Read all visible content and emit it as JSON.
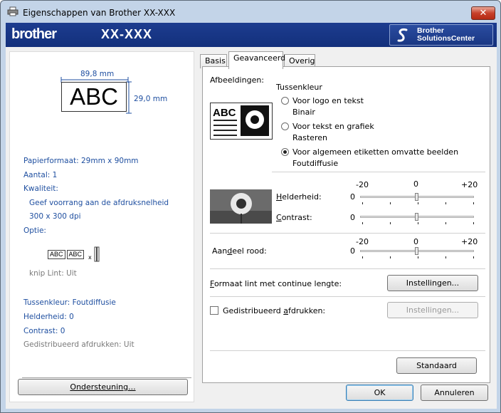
{
  "window": {
    "title": "Eigenschappen van Brother XX-XXX",
    "close_glyph": "✕"
  },
  "banner": {
    "brand": "brother",
    "model": "XX-XXX",
    "solutions_line1": "Brother",
    "solutions_line2": "SolutionsCenter"
  },
  "preview": {
    "width_label": "89,8 mm",
    "height_label": "29,0 mm",
    "sample_text": "ABC"
  },
  "info": {
    "paper": "Papierformaat: 29mm x 90mm",
    "copies": "Aantal: 1",
    "quality": "Kwaliteit:",
    "quality_value": "Geef voorrang aan de afdruksnelheid",
    "resolution": "300 x 300 dpi",
    "option": "Optie:",
    "option_sample": "ABC",
    "cut": "knip Lint: Uit",
    "halftone": "Tussenkleur: Foutdiffusie",
    "brightness": "Helderheid:  0",
    "contrast": "Contrast:  0",
    "distributed": "Gedistribueerd afdrukken: Uit"
  },
  "support_button": "Ondersteuning...",
  "tabs": [
    {
      "label": "Basis"
    },
    {
      "label": "Geavanceerd"
    },
    {
      "label": "Overig"
    }
  ],
  "advanced": {
    "images_label": "Afbeeldingen:",
    "halftone_label": "Tussenkleur",
    "options": [
      {
        "label": "Voor logo en tekst",
        "sub": "Binair",
        "selected": false
      },
      {
        "label": "Voor tekst en grafiek",
        "sub": "Rasteren",
        "selected": false
      },
      {
        "label": "Voor algemeen etiketten omvatte beelden",
        "sub": "Foutdiffusie",
        "selected": true
      }
    ],
    "scale": {
      "min": "-20",
      "mid": "0",
      "max": "+20"
    },
    "brightness_label": "Helderheid:",
    "brightness_value": "0",
    "brightness": 0,
    "contrast_label": "Contrast:",
    "contrast_value": "0",
    "contrast": 0,
    "red_label": "Aandeel rood:",
    "red_value": "0",
    "red": 0,
    "format_label": "Formaat lint met continue lengte:",
    "format_button": "Instellingen...",
    "distributed_label": "Gedistribueerd afdrukken:",
    "distributed_checked": false,
    "distributed_button": "Instellingen...",
    "default_button": "Standaard"
  },
  "footer": {
    "ok": "OK",
    "cancel": "Annuleren"
  }
}
